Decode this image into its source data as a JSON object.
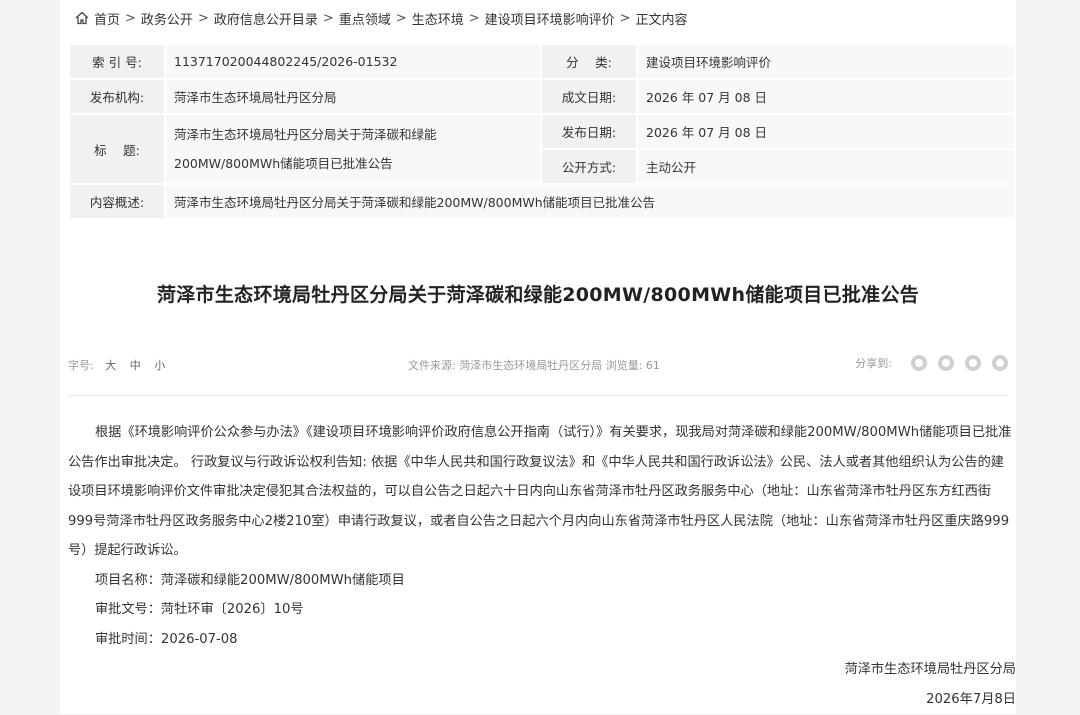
{
  "breadcrumb": [
    "首页",
    "政务公开",
    "政府信息公开目录",
    "重点领域",
    "生态环境",
    "建设项目环境影响评价",
    "正文内容"
  ],
  "breadcrumb_sep": ">",
  "meta": {
    "index_label": "索 引 号:",
    "index_value": "113717020044802245/2026-01532",
    "category_label": "分　 类:",
    "category_value": "建设项目环境影响评价",
    "publisher_label": "发布机构:",
    "publisher_value": "菏泽市生态环境局牡丹区分局",
    "created_label": "成文日期:",
    "created_value": "2026 年 07 月 08 日",
    "title_label": "标　 题:",
    "title_value": "菏泽市生态环境局牡丹区分局关于菏泽碳和绿能200MW/800MWh储能项目已批准公告",
    "pubdate_label": "发布日期:",
    "pubdate_value": "2026 年 07 月 08 日",
    "mode_label": "公开方式:",
    "mode_value": "主动公开",
    "summary_label": "内容概述:",
    "summary_value": "菏泽市生态环境局牡丹区分局关于菏泽碳和绿能200MW/800MWh储能项目已批准公告"
  },
  "doc_title": "菏泽市生态环境局牡丹区分局关于菏泽碳和绿能200MW/800MWh储能项目已批准公告",
  "tools": {
    "font_size_label": "字号:",
    "font_large": "大",
    "font_medium": "中",
    "font_small": "小",
    "source": "文件来源: 菏泽市生态环境局牡丹区分局 浏览量: 61",
    "share_label": "分享到:"
  },
  "body": {
    "paragraph": "根据《环境影响评价公众参与办法》《建设项目环境影响评价政府信息公开指南（试行）》有关要求，现我局对菏泽碳和绿能200MW/800MWh储能项目已批准公告作出审批决定。 行政复议与行政诉讼权利告知: 依据《中华人民共和国行政复议法》和《中华人民共和国行政诉讼法》公民、法人或者其他组织认为公告的建设项目环境影响评价文件审批决定侵犯其合法权益的，可以自公告之日起六十日内向山东省菏泽市牡丹区政务服务中心（地址：山东省菏泽市牡丹区东方红西街999号菏泽市牡丹区政务服务中心2楼210室）申请行政复议，或者自公告之日起六个月内向山东省菏泽市牡丹区人民法院（地址：山东省菏泽市牡丹区重庆路999号）提起行政诉讼。",
    "project_line": "项目名称：菏泽碳和绿能200MW/800MWh储能项目",
    "approval_no_line": "审批文号：菏牡环审〔2026〕10号",
    "approval_time_line": "审批时间：2026-07-08"
  },
  "signature": {
    "org": "菏泽市生态环境局牡丹区分局",
    "date": "2026年7月8日"
  }
}
